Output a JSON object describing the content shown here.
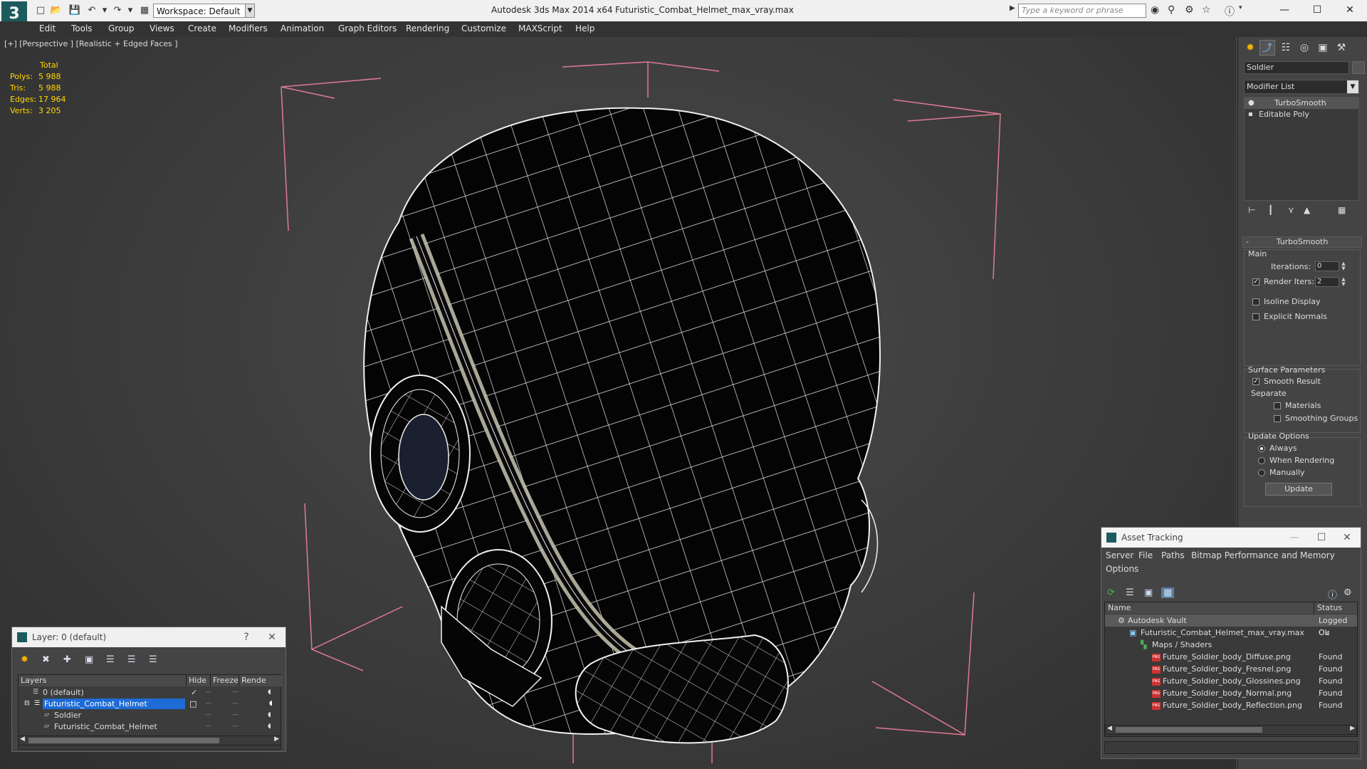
{
  "title_bar": {
    "workspace_label": "Workspace: Default",
    "app_title": "Autodesk 3ds Max  2014 x64",
    "document": "Futuristic_Combat_Helmet_max_vray.max",
    "search_placeholder": "Type a keyword or phrase"
  },
  "menu": [
    "Edit",
    "Tools",
    "Group",
    "Views",
    "Create",
    "Modifiers",
    "Animation",
    "Graph Editors",
    "Rendering",
    "Customize",
    "MAXScript",
    "Help"
  ],
  "viewport": {
    "label": "[+] [Perspective ] [Realistic + Edged Faces ]",
    "stats": {
      "header": "Total",
      "rows": [
        {
          "key": "Polys:",
          "value": "5 988"
        },
        {
          "key": "Tris:",
          "value": "5 988"
        },
        {
          "key": "Edges:",
          "value": "17 964"
        },
        {
          "key": "Verts:",
          "value": "3 205"
        }
      ]
    }
  },
  "command_panel": {
    "object_name": "Soldier",
    "modifier_list": "Modifier List",
    "stack": [
      "TurboSmooth",
      "Editable Poly"
    ],
    "turbosmooth": {
      "title": "TurboSmooth",
      "main_label": "Main",
      "iterations_label": "Iterations:",
      "iterations_value": "0",
      "render_iters_label": "Render Iters:",
      "render_iters_value": "2",
      "isoline_label": "Isoline Display",
      "explicit_normals_label": "Explicit Normals",
      "surface_params_label": "Surface Parameters",
      "smooth_result_label": "Smooth Result",
      "separate_label": "Separate",
      "materials_label": "Materials",
      "smoothing_groups_label": "Smoothing Groups",
      "update_options_label": "Update Options",
      "always_label": "Always",
      "when_rendering_label": "When Rendering",
      "manually_label": "Manually",
      "update_button": "Update"
    }
  },
  "layer_panel": {
    "title": "Layer: 0 (default)",
    "help": "?",
    "columns": [
      "Layers",
      "Hide",
      "Freeze",
      "Rende"
    ],
    "rows": [
      {
        "name": "0 (default)"
      },
      {
        "name": "Futuristic_Combat_Helmet"
      },
      {
        "name": "Soldier"
      },
      {
        "name": "Futuristic_Combat_Helmet"
      }
    ]
  },
  "asset_tracking": {
    "title": "Asset Tracking",
    "menu": [
      "Server",
      "File",
      "Paths",
      "Bitmap Performance and Memory",
      "Options"
    ],
    "columns": [
      "Name",
      "Status"
    ],
    "rows": [
      {
        "name": "Autodesk Vault",
        "status": "Logged Ou"
      },
      {
        "name": "Futuristic_Combat_Helmet_max_vray.max",
        "status": "Ok"
      },
      {
        "name": "Maps / Shaders",
        "status": ""
      },
      {
        "name": "Future_Soldier_body_Diffuse.png",
        "status": "Found"
      },
      {
        "name": "Future_Soldier_body_Fresnel.png",
        "status": "Found"
      },
      {
        "name": "Future_Soldier_body_Glossines.png",
        "status": "Found"
      },
      {
        "name": "Future_Soldier_body_Normal.png",
        "status": "Found"
      },
      {
        "name": "Future_Soldier_body_Reflection.png",
        "status": "Found"
      }
    ]
  }
}
